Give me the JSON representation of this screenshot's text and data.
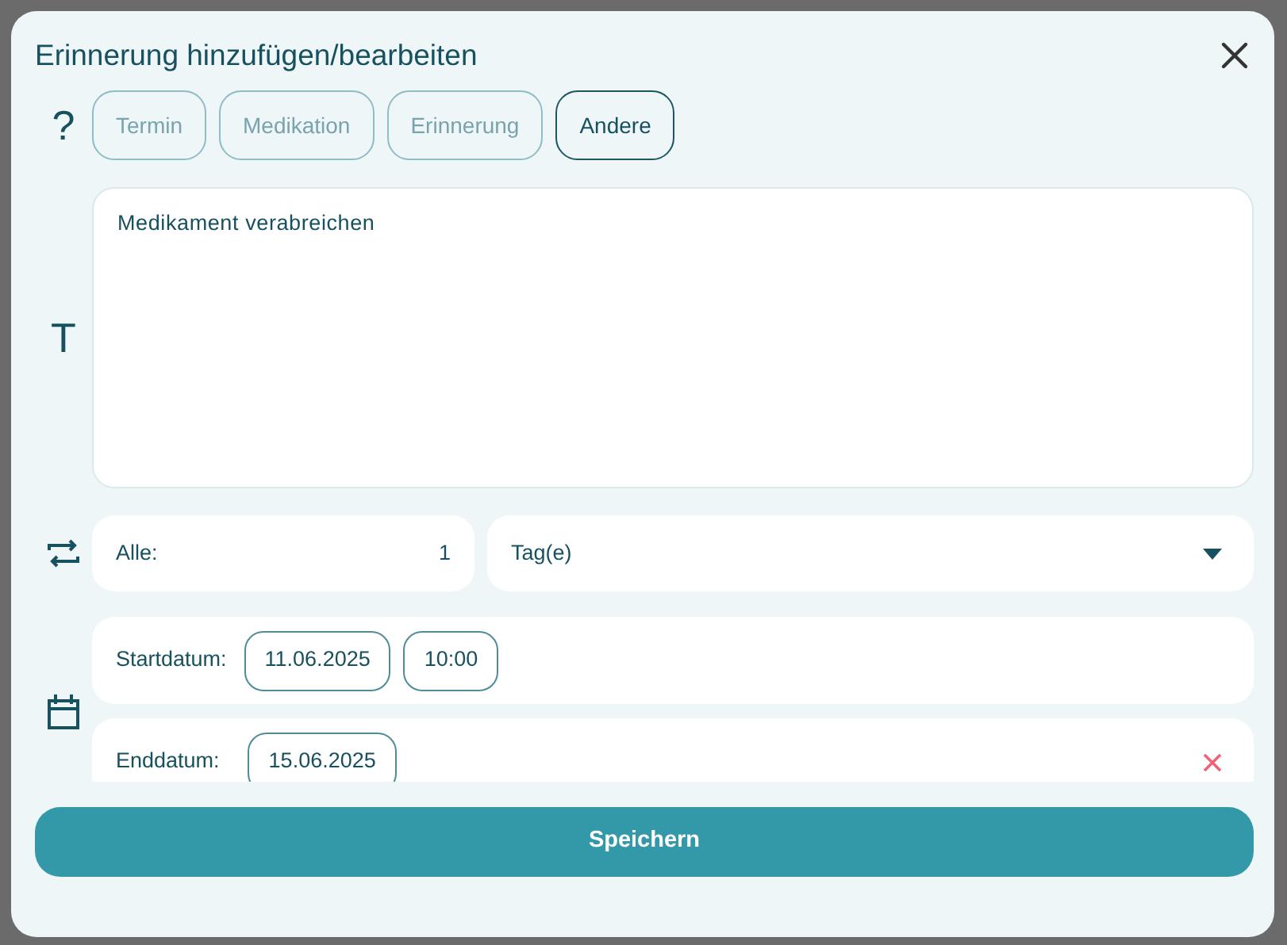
{
  "dialog": {
    "title": "Erinnerung hinzufügen/bearbeiten",
    "type_icon": "?",
    "type_tabs": [
      {
        "label": "Termin",
        "selected": false
      },
      {
        "label": "Medikation",
        "selected": false
      },
      {
        "label": "Erinnerung",
        "selected": false
      },
      {
        "label": "Andere",
        "selected": true
      }
    ],
    "text_icon": "T",
    "text": {
      "value": "Medikament verabreichen"
    },
    "repeat": {
      "label": "Alle:",
      "value": "1",
      "unit": "Tag(e)"
    },
    "start": {
      "label": "Startdatum:",
      "date": "11.06.2025",
      "time": "10:00"
    },
    "end": {
      "label": "Enddatum:",
      "date": "15.06.2025"
    },
    "save_button": "Speichern"
  }
}
